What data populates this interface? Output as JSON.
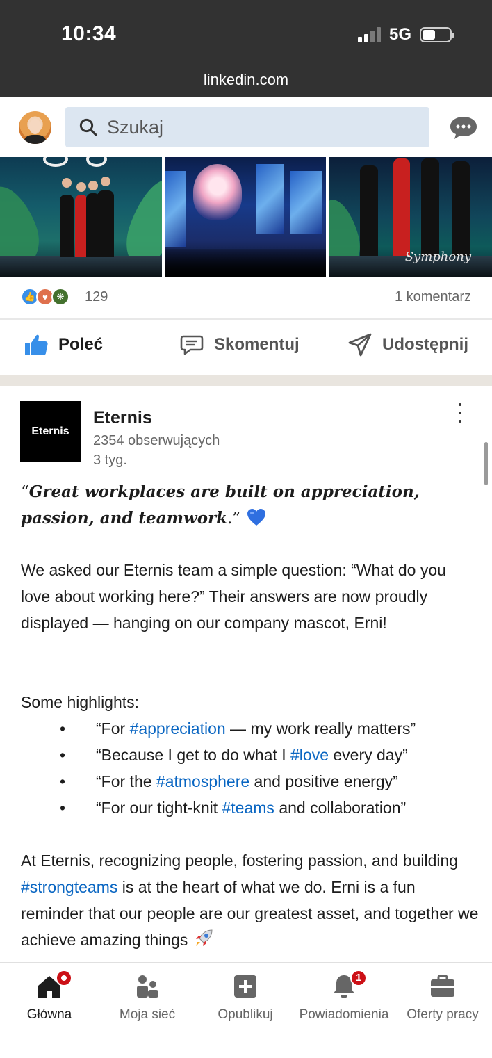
{
  "status_bar": {
    "time": "10:34",
    "network": "5G",
    "url": "linkedin.com"
  },
  "header": {
    "search_placeholder": "Szukaj"
  },
  "prev_post": {
    "reaction_count": "129",
    "comments": "1 komentarz",
    "actions": {
      "like": "Poleć",
      "comment": "Skomentuj",
      "share": "Udostępnij"
    }
  },
  "post": {
    "company": "Eternis",
    "logo_text": "Eternis",
    "followers": "2354 obserwujących",
    "time": "3 tyg.",
    "quote_open": "“",
    "quote_bold": "Great workplaces are built on appreciation, passion, and teamwork",
    "quote_close": ".”",
    "paragraph1": "We asked our Eternis team a simple question: “What do you love about working here?” Their answers are now proudly displayed — hanging on our company mascot, Erni!",
    "highlights_label": "Some highlights:",
    "bullets": [
      {
        "before": "“For ",
        "tag": "#appreciation",
        "after": " — my work really matters”"
      },
      {
        "before": "“Because I get to do what I ",
        "tag": "#love",
        "after": " every day”"
      },
      {
        "before": "“For the ",
        "tag": "#atmosphere",
        "after": " and positive energy”"
      },
      {
        "before": "“For our tight-knit ",
        "tag": "#teams",
        "after": " and collaboration”"
      }
    ],
    "paragraph2_before": "At Eternis, recognizing people, fostering passion, and building ",
    "paragraph2_tag": "#strongteams",
    "paragraph2_after": " is at the heart of what we do. Erni is a fun reminder that our people are our greatest asset, and together we achieve amazing things "
  },
  "bottom_nav": {
    "items": [
      {
        "label": "Główna",
        "icon": "home-icon"
      },
      {
        "label": "Moja sieć",
        "icon": "network-icon"
      },
      {
        "label": "Opublikuj",
        "icon": "post-icon"
      },
      {
        "label": "Powiadomienia",
        "icon": "bell-icon",
        "badge": "1"
      },
      {
        "label": "Oferty pracy",
        "icon": "briefcase-icon"
      }
    ]
  },
  "colors": {
    "link": "#0a66c2",
    "status_bar": "#323232",
    "search_bg": "#dce6f1",
    "badge": "#cc1016"
  }
}
